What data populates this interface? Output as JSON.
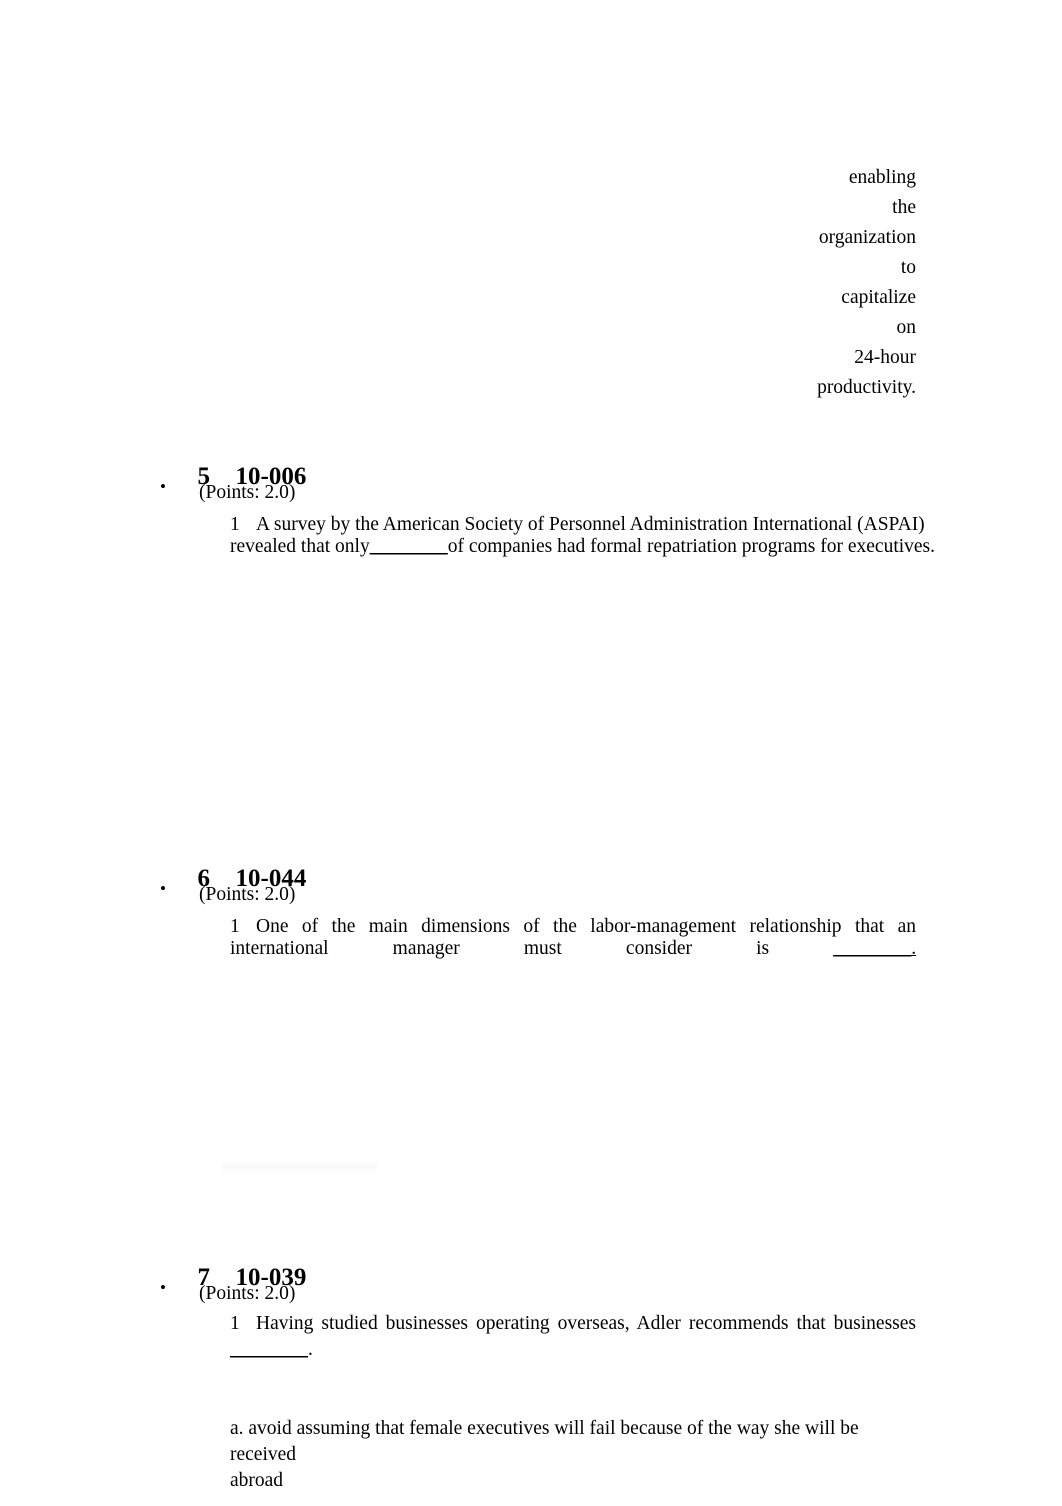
{
  "page": {
    "background_color": "#ffffff",
    "text_color": "#000000"
  },
  "continuation_line": {
    "words": [
      "enabling",
      "the",
      "organization",
      "to",
      "capitalize",
      "on",
      "24-hour",
      "productivity."
    ],
    "full_text": "enabling the organization to capitalize on 24-hour productivity."
  },
  "questions": [
    {
      "number": "5",
      "code": "10-006",
      "points": "(Points: 2.0)",
      "bullet": "•",
      "marker": "1",
      "line1": "A survey by the American Society of Personnel Administration International (ASPAI)",
      "line2_pre": "revealed that only",
      "line2_blank": "________",
      "line2_post": "of companies had formal repatriation programs for executives.",
      "full_text": "A survey by the American Society of Personnel Administration International (ASPAI) revealed that only________of companies had formal repatriation programs for executives.",
      "answers": []
    },
    {
      "number": "6",
      "code": "10-044",
      "points": "(Points: 2.0)",
      "bullet": "•",
      "marker": "1",
      "line1": "One of the main dimensions of the labor-management relationship that an",
      "line2_words": [
        "international",
        "manager",
        "must",
        "consider",
        "is",
        "________."
      ],
      "line2_text": "international manager must consider is ________.",
      "full_text": "One of the main dimensions of the labor-management relationship that an international manager must consider is ________.",
      "answers": []
    },
    {
      "number": "7",
      "code": "10-039",
      "points": "(Points: 2.0)",
      "bullet": "•",
      "marker": "1",
      "line1": "Having studied businesses operating overseas, Adler recommends that businesses",
      "line2_blank": "________",
      "line2_post": ".",
      "full_text": "Having studied businesses operating overseas, Adler recommends that businesses ________.",
      "answers": [
        {
          "label": "a.",
          "line1": " a. avoid assuming that female executives will fail because of the way she will be received",
          "line2": "abroad",
          "text": "a. avoid assuming that female executives will fail because of the way she will be received abroad"
        }
      ]
    }
  ]
}
